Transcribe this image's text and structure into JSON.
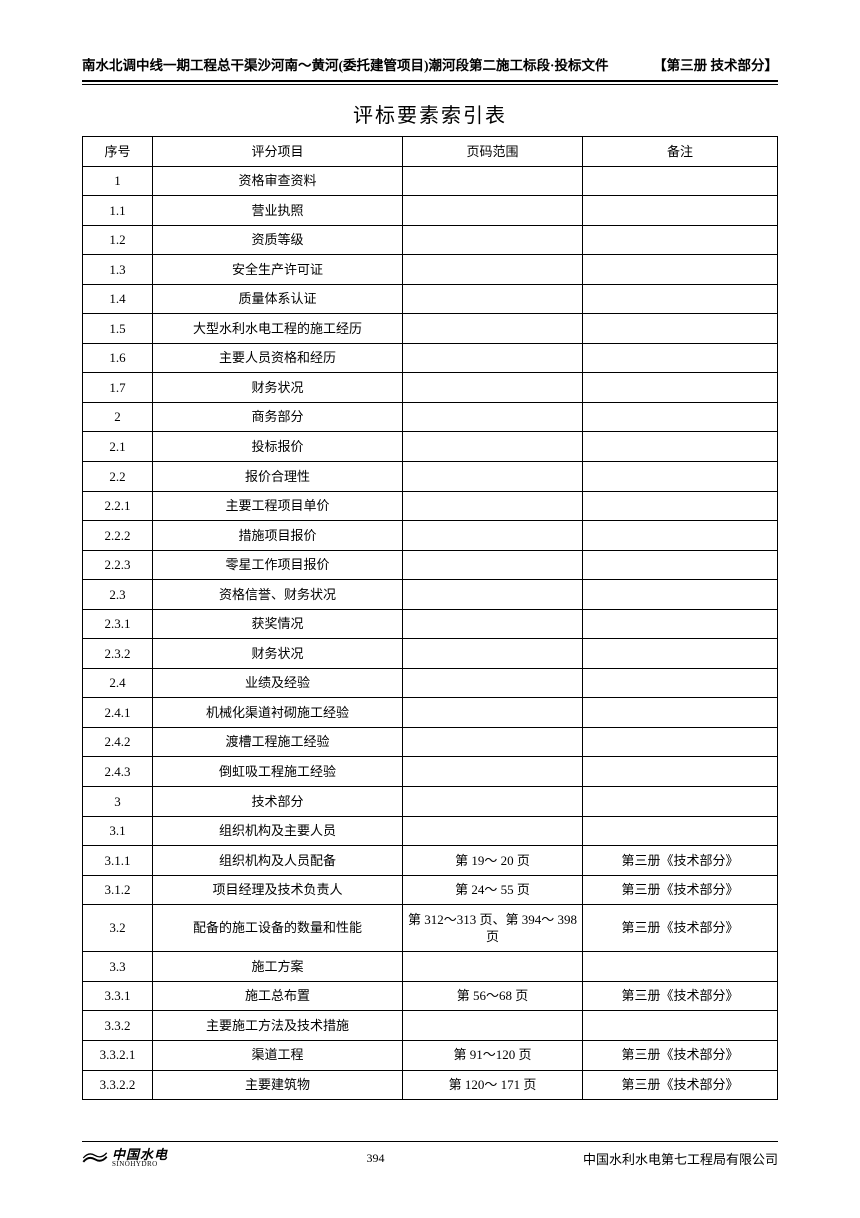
{
  "header": {
    "left": "南水北调中线一期工程总干渠沙河南～黄河(委托建管项目)潮河段第二施工标段·投标文件",
    "right": "【第三册 技术部分】"
  },
  "title": "评标要素索引表",
  "columns": [
    "序号",
    "评分项目",
    "页码范围",
    "备注"
  ],
  "rows": [
    {
      "no": "1",
      "item": "资格审查资料",
      "range": "",
      "note": ""
    },
    {
      "no": "1.1",
      "item": "营业执照",
      "range": "",
      "note": ""
    },
    {
      "no": "1.2",
      "item": "资质等级",
      "range": "",
      "note": ""
    },
    {
      "no": "1.3",
      "item": "安全生产许可证",
      "range": "",
      "note": ""
    },
    {
      "no": "1.4",
      "item": "质量体系认证",
      "range": "",
      "note": ""
    },
    {
      "no": "1.5",
      "item": "大型水利水电工程的施工经历",
      "range": "",
      "note": ""
    },
    {
      "no": "1.6",
      "item": "主要人员资格和经历",
      "range": "",
      "note": ""
    },
    {
      "no": "1.7",
      "item": "财务状况",
      "range": "",
      "note": ""
    },
    {
      "no": "2",
      "item": "商务部分",
      "range": "",
      "note": ""
    },
    {
      "no": "2.1",
      "item": "投标报价",
      "range": "",
      "note": ""
    },
    {
      "no": "2.2",
      "item": "报价合理性",
      "range": "",
      "note": ""
    },
    {
      "no": "2.2.1",
      "item": "主要工程项目单价",
      "range": "",
      "note": ""
    },
    {
      "no": "2.2.2",
      "item": "措施项目报价",
      "range": "",
      "note": ""
    },
    {
      "no": "2.2.3",
      "item": "零星工作项目报价",
      "range": "",
      "note": ""
    },
    {
      "no": "2.3",
      "item": "资格信誉、财务状况",
      "range": "",
      "note": ""
    },
    {
      "no": "2.3.1",
      "item": "获奖情况",
      "range": "",
      "note": ""
    },
    {
      "no": "2.3.2",
      "item": "财务状况",
      "range": "",
      "note": ""
    },
    {
      "no": "2.4",
      "item": "业绩及经验",
      "range": "",
      "note": ""
    },
    {
      "no": "2.4.1",
      "item": "机械化渠道衬砌施工经验",
      "range": "",
      "note": ""
    },
    {
      "no": "2.4.2",
      "item": "渡槽工程施工经验",
      "range": "",
      "note": ""
    },
    {
      "no": "2.4.3",
      "item": "倒虹吸工程施工经验",
      "range": "",
      "note": ""
    },
    {
      "no": "3",
      "item": "技术部分",
      "range": "",
      "note": ""
    },
    {
      "no": "3.1",
      "item": "组织机构及主要人员",
      "range": "",
      "note": ""
    },
    {
      "no": "3.1.1",
      "item": "组织机构及人员配备",
      "range": "第 19～ 20 页",
      "note": "第三册《技术部分》"
    },
    {
      "no": "3.1.2",
      "item": "项目经理及技术负责人",
      "range": "第 24～ 55 页",
      "note": "第三册《技术部分》"
    },
    {
      "no": "3.2",
      "item": "配备的施工设备的数量和性能",
      "range": "第 312～313 页、第 394～ 398 页",
      "note": "第三册《技术部分》"
    },
    {
      "no": "3.3",
      "item": "施工方案",
      "range": "",
      "note": ""
    },
    {
      "no": "3.3.1",
      "item": "施工总布置",
      "range": "第 56～68 页",
      "note": "第三册《技术部分》"
    },
    {
      "no": "3.3.2",
      "item": "主要施工方法及技术措施",
      "range": "",
      "note": ""
    },
    {
      "no": "3.3.2.1",
      "item": "渠道工程",
      "range": "第 91～120 页",
      "note": "第三册《技术部分》"
    },
    {
      "no": "3.3.2.2",
      "item": "主要建筑物",
      "range": "第 120～ 171 页",
      "note": "第三册《技术部分》"
    }
  ],
  "footer": {
    "logo_cn": "中国水电",
    "logo_en": "SINOHYDRO",
    "page_num": "394",
    "company": "中国水利水电第七工程局有限公司"
  }
}
